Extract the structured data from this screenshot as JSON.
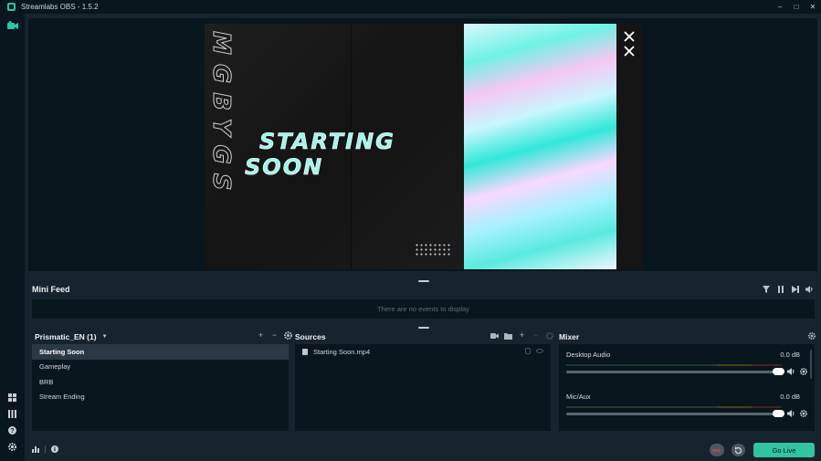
{
  "window": {
    "title": "Streamlabs OBS - 1.5.2",
    "controls": [
      "–",
      "□",
      "✕"
    ]
  },
  "sidebar": {
    "top_icon": "studio-camera-icon",
    "bottom_icons": [
      "layout-editor-icon",
      "studio-mode-icon",
      "help-icon",
      "settings-icon"
    ]
  },
  "preview": {
    "overlay_side_text": "MGBYGS",
    "overlay_title_line1": "STARTING",
    "overlay_title_line2": "SOON"
  },
  "mini_feed": {
    "title": "Mini Feed",
    "empty_message": "There are no events to display",
    "controls": [
      "filter-icon",
      "pause-icon",
      "skip-icon",
      "volume-icon"
    ]
  },
  "scenes": {
    "collection_name": "Prismatic_EN (1)",
    "items": [
      {
        "label": "Starting Soon",
        "active": true
      },
      {
        "label": "Gameplay",
        "active": false
      },
      {
        "label": "BRB",
        "active": false
      },
      {
        "label": "Stream Ending",
        "active": false
      }
    ]
  },
  "sources": {
    "title": "Sources",
    "items": [
      {
        "label": "Starting Soon.mp4"
      }
    ]
  },
  "mixer": {
    "title": "Mixer",
    "channels": [
      {
        "name": "Desktop Audio",
        "level": "0.0 dB",
        "volume_fraction": 1.0
      },
      {
        "name": "Mic/Aux",
        "level": "0.0 dB",
        "volume_fraction": 1.0
      }
    ]
  },
  "footer": {
    "rec_label": "REC",
    "go_live_label": "Go Live"
  },
  "colors": {
    "accent": "#31c3a2",
    "background": "#17242d",
    "panel": "#09161d"
  }
}
